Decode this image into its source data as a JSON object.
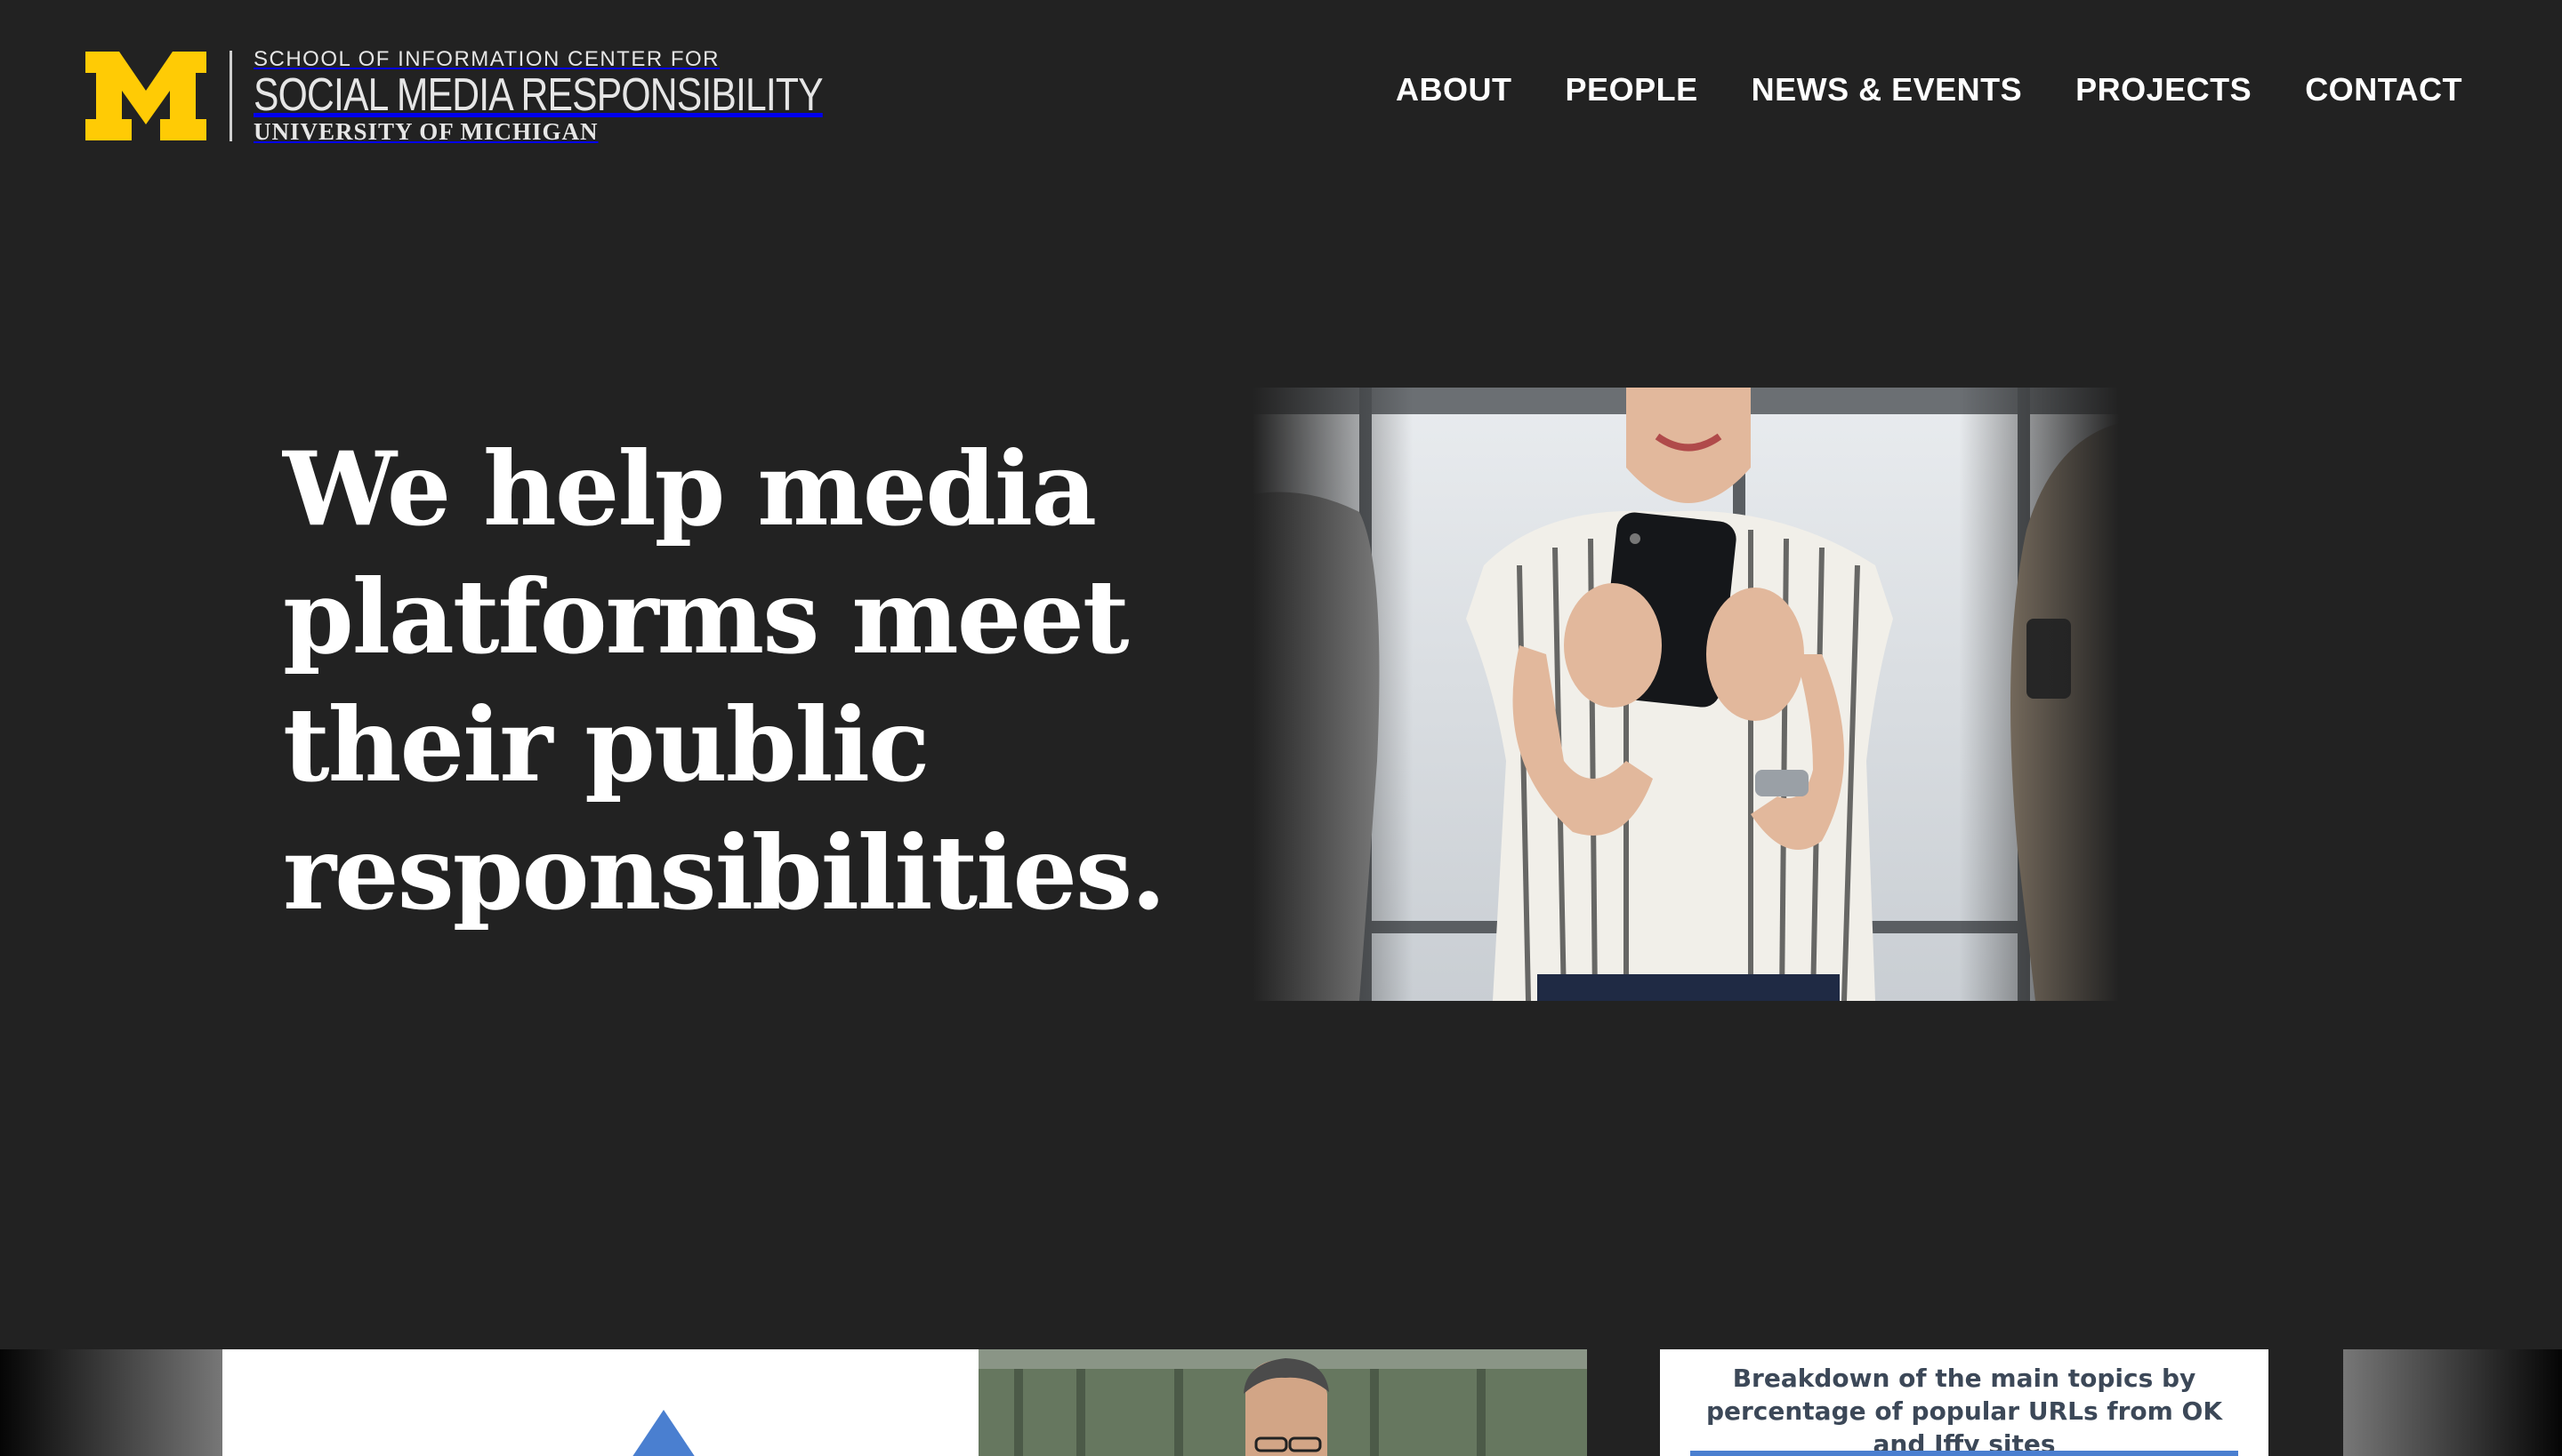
{
  "header": {
    "logo": {
      "line1": "SCHOOL OF INFORMATION CENTER FOR",
      "line2": "SOCIAL MEDIA RESPONSIBILITY",
      "line3": "UNIVERSITY OF MICHIGAN",
      "brand_color": "#FFCB05"
    },
    "nav": [
      {
        "label": "ABOUT"
      },
      {
        "label": "PEOPLE"
      },
      {
        "label": "NEWS & EVENTS"
      },
      {
        "label": "PROJECTS"
      },
      {
        "label": "CONTACT"
      }
    ]
  },
  "hero": {
    "headline": "We help media platforms meet their public responsibilities.",
    "image_icon": "woman-using-smartphone-photo"
  },
  "cards": {
    "chart_card": {
      "title": "Breakdown of the main topics by percentage of popular URLs from OK and Iffy sites"
    }
  },
  "colors": {
    "background": "#222222",
    "text": "#FFFFFF",
    "accent_blue": "#4A7FD0"
  }
}
